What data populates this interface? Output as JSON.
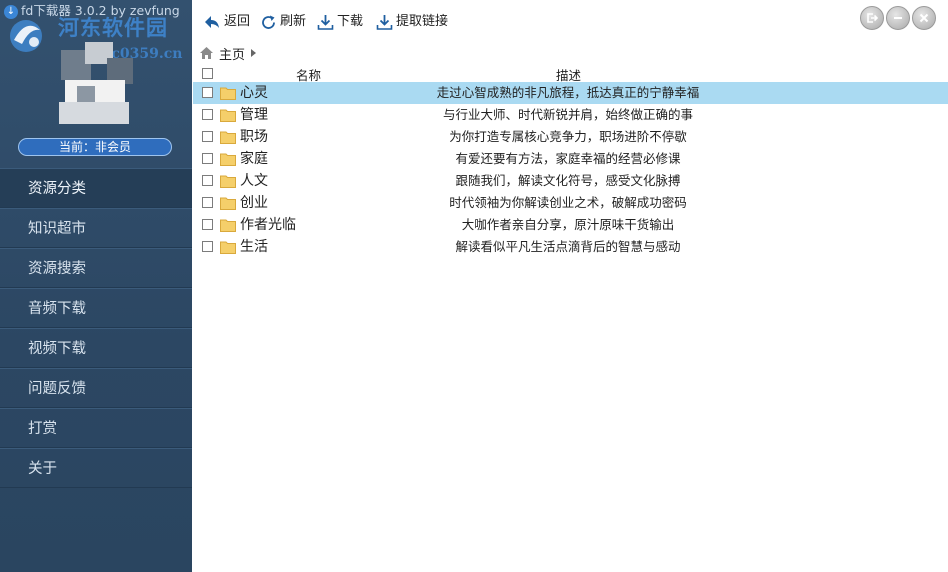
{
  "app": {
    "title": "fd下载器 3.0.2 by zevfung"
  },
  "watermark": {
    "text": "河东软件园",
    "url": "www.pc0359.cn"
  },
  "user": {
    "member_status": "当前：非会员"
  },
  "sidebar": {
    "items": [
      {
        "label": "资源分类",
        "active": true
      },
      {
        "label": "知识超市"
      },
      {
        "label": "资源搜索"
      },
      {
        "label": "音频下载"
      },
      {
        "label": "视频下载"
      },
      {
        "label": "问题反馈"
      },
      {
        "label": "打赏"
      },
      {
        "label": "关于"
      }
    ]
  },
  "toolbar": {
    "back": "返回",
    "refresh": "刷新",
    "download": "下载",
    "extract": "提取链接"
  },
  "breadcrumb": {
    "home": "主页"
  },
  "table": {
    "headers": {
      "name": "名称",
      "desc": "描述"
    },
    "rows": [
      {
        "name": "心灵",
        "desc": "走过心智成熟的非凡旅程，抵达真正的宁静幸福",
        "selected": true
      },
      {
        "name": "管理",
        "desc": "与行业大师、时代新锐并肩，始终做正确的事"
      },
      {
        "name": "职场",
        "desc": "为你打造专属核心竞争力，职场进阶不停歇"
      },
      {
        "name": "家庭",
        "desc": "有爱还要有方法，家庭幸福的经营必修课"
      },
      {
        "name": "人文",
        "desc": "跟随我们，解读文化符号，感受文化脉搏"
      },
      {
        "name": "创业",
        "desc": "时代领袖为你解读创业之术，破解成功密码"
      },
      {
        "name": "作者光临",
        "desc": "大咖作者亲自分享，原汁原味干货输出"
      },
      {
        "name": "生活",
        "desc": "解读看似平凡生活点滴背后的智慧与感动"
      }
    ]
  },
  "colors": {
    "sidebar_bg": "#2c4763",
    "selected_row": "#aadaf2",
    "folder": "#f5cf6a"
  },
  "icons": [
    "back-arrow-icon",
    "refresh-icon",
    "download-icon",
    "extract-link-icon",
    "home-icon",
    "folder-icon",
    "logout-icon",
    "minimize-icon",
    "close-icon"
  ]
}
